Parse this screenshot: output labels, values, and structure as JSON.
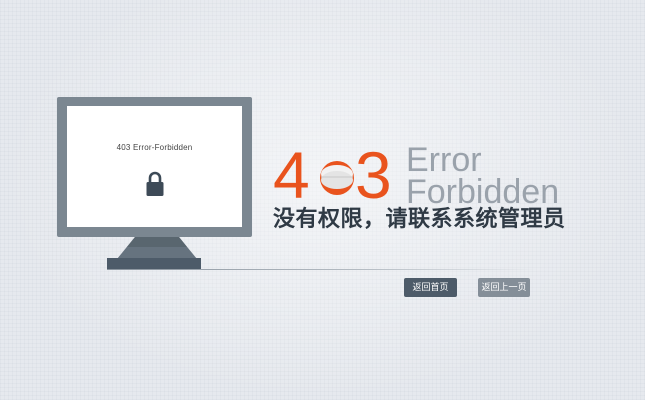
{
  "screen": {
    "error_text": "403 Error-Forbidden"
  },
  "hero": {
    "digit_left": "4",
    "digit_right": "3",
    "error_word": "Error",
    "forbidden_word": "Forbidden",
    "message": "没有权限，请联系系统管理员"
  },
  "buttons": {
    "home": "返回首页",
    "back": "返回上一页"
  },
  "icons": {
    "lock": "lock-icon",
    "pill": "pill-icon"
  },
  "colors": {
    "accent": "#e9531d",
    "monitor": "#7b8791",
    "primary_button": "#4d5b69",
    "secondary_button": "#848e98",
    "text_dark": "#2f3a45",
    "text_muted": "#9aa2ab",
    "background": "#e6e9ee"
  }
}
